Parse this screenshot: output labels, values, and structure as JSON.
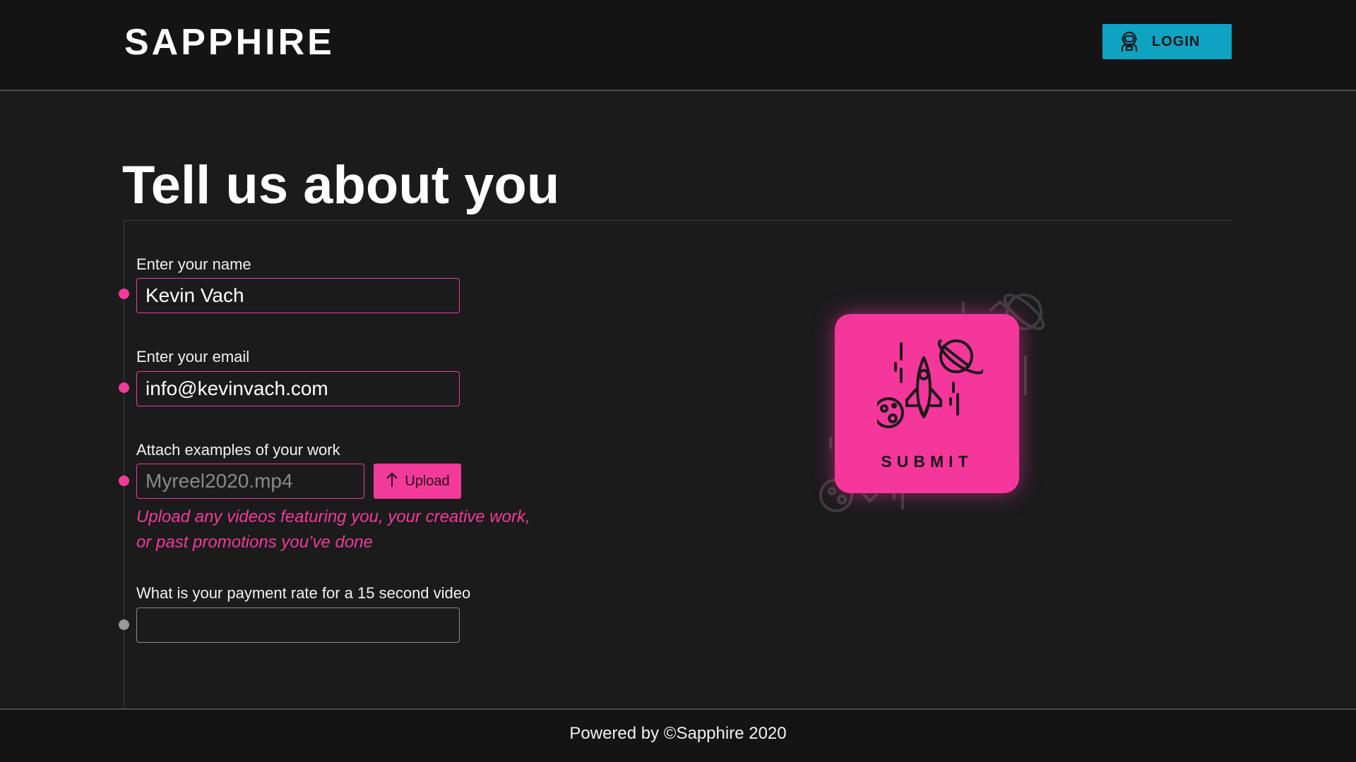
{
  "header": {
    "logo": "SAPPHIRE",
    "login_label": "LOGIN",
    "login_icon": "astronaut-icon"
  },
  "main": {
    "title": "Tell us about you",
    "fields": {
      "name": {
        "label": "Enter your name",
        "value": "Kevin Vach"
      },
      "email": {
        "label": "Enter your email",
        "value": "info@kevinvach.com"
      },
      "work": {
        "label": "Attach examples of your work",
        "placeholder": "Myreel2020.mp4",
        "upload_label": "Upload",
        "upload_icon": "arrow-up-icon",
        "hint_line1": "Upload any videos featuring you, your creative work,",
        "hint_line2": "or past promotions you’ve done"
      },
      "rate": {
        "label": "What is your payment rate for a 15 second video",
        "value": ""
      }
    },
    "submit": {
      "label": "SUBMIT",
      "icon": "rocket-icon"
    }
  },
  "footer": {
    "text": "Powered by ©Sapphire 2020"
  },
  "colors": {
    "accent": "#f23a9a",
    "login": "#0fa3c1",
    "background": "#1b1b1c"
  }
}
